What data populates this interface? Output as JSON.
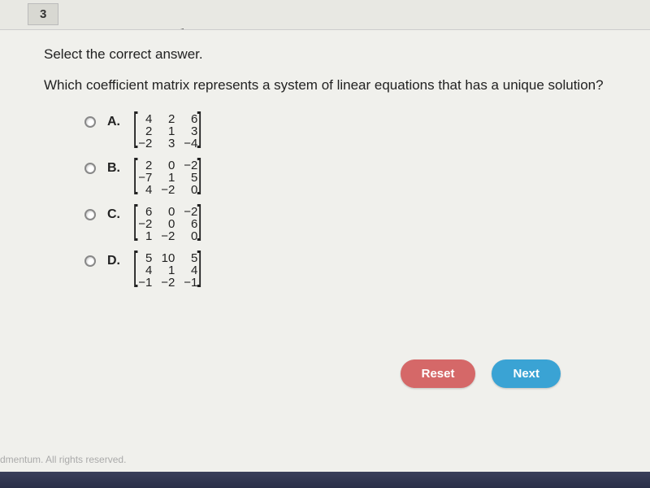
{
  "page_number": "3",
  "instruction": "Select the correct answer.",
  "question": "Which coefficient matrix represents a system of linear equations that has a unique solution?",
  "options": [
    {
      "label": "A.",
      "matrix": [
        [
          "4",
          "2",
          "6"
        ],
        [
          "2",
          "1",
          "3"
        ],
        [
          "−2",
          "3",
          "−4"
        ]
      ]
    },
    {
      "label": "B.",
      "matrix": [
        [
          "2",
          "0",
          "−2"
        ],
        [
          "−7",
          "1",
          "5"
        ],
        [
          "4",
          "−2",
          "0"
        ]
      ]
    },
    {
      "label": "C.",
      "matrix": [
        [
          "6",
          "0",
          "−2"
        ],
        [
          "−2",
          "0",
          "6"
        ],
        [
          "1",
          "−2",
          "0"
        ]
      ]
    },
    {
      "label": "D.",
      "matrix": [
        [
          "5",
          "10",
          "5"
        ],
        [
          "4",
          "1",
          "4"
        ],
        [
          "−1",
          "−2",
          "−1"
        ]
      ]
    }
  ],
  "buttons": {
    "reset": "Reset",
    "next": "Next"
  },
  "footer": "dmentum. All rights reserved."
}
